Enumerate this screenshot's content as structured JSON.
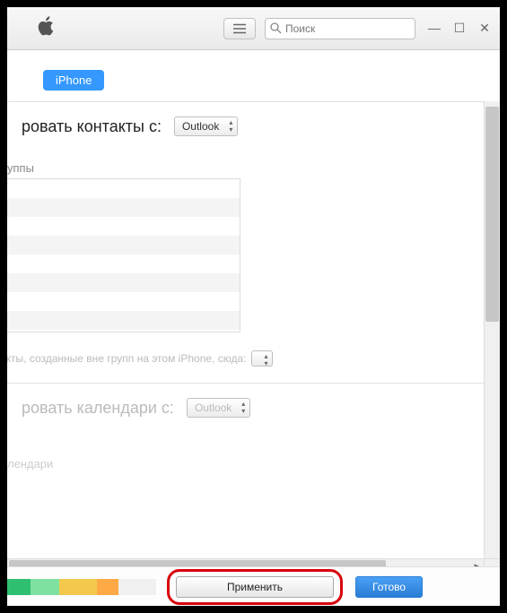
{
  "titlebar": {
    "search_placeholder": "Поиск"
  },
  "tabs": {
    "iphone": "iPhone"
  },
  "contacts": {
    "label": "ровать контакты с:",
    "selected": "Outlook",
    "groups_label": "уппы",
    "outside_note": "нтакты, созданные вне групп на этом iPhone, сюда:"
  },
  "calendars": {
    "label": "ровать календари с:",
    "selected": "Outlook",
    "sub_label": "лендари"
  },
  "footer": {
    "apply": "Применить",
    "done": "Готово"
  }
}
